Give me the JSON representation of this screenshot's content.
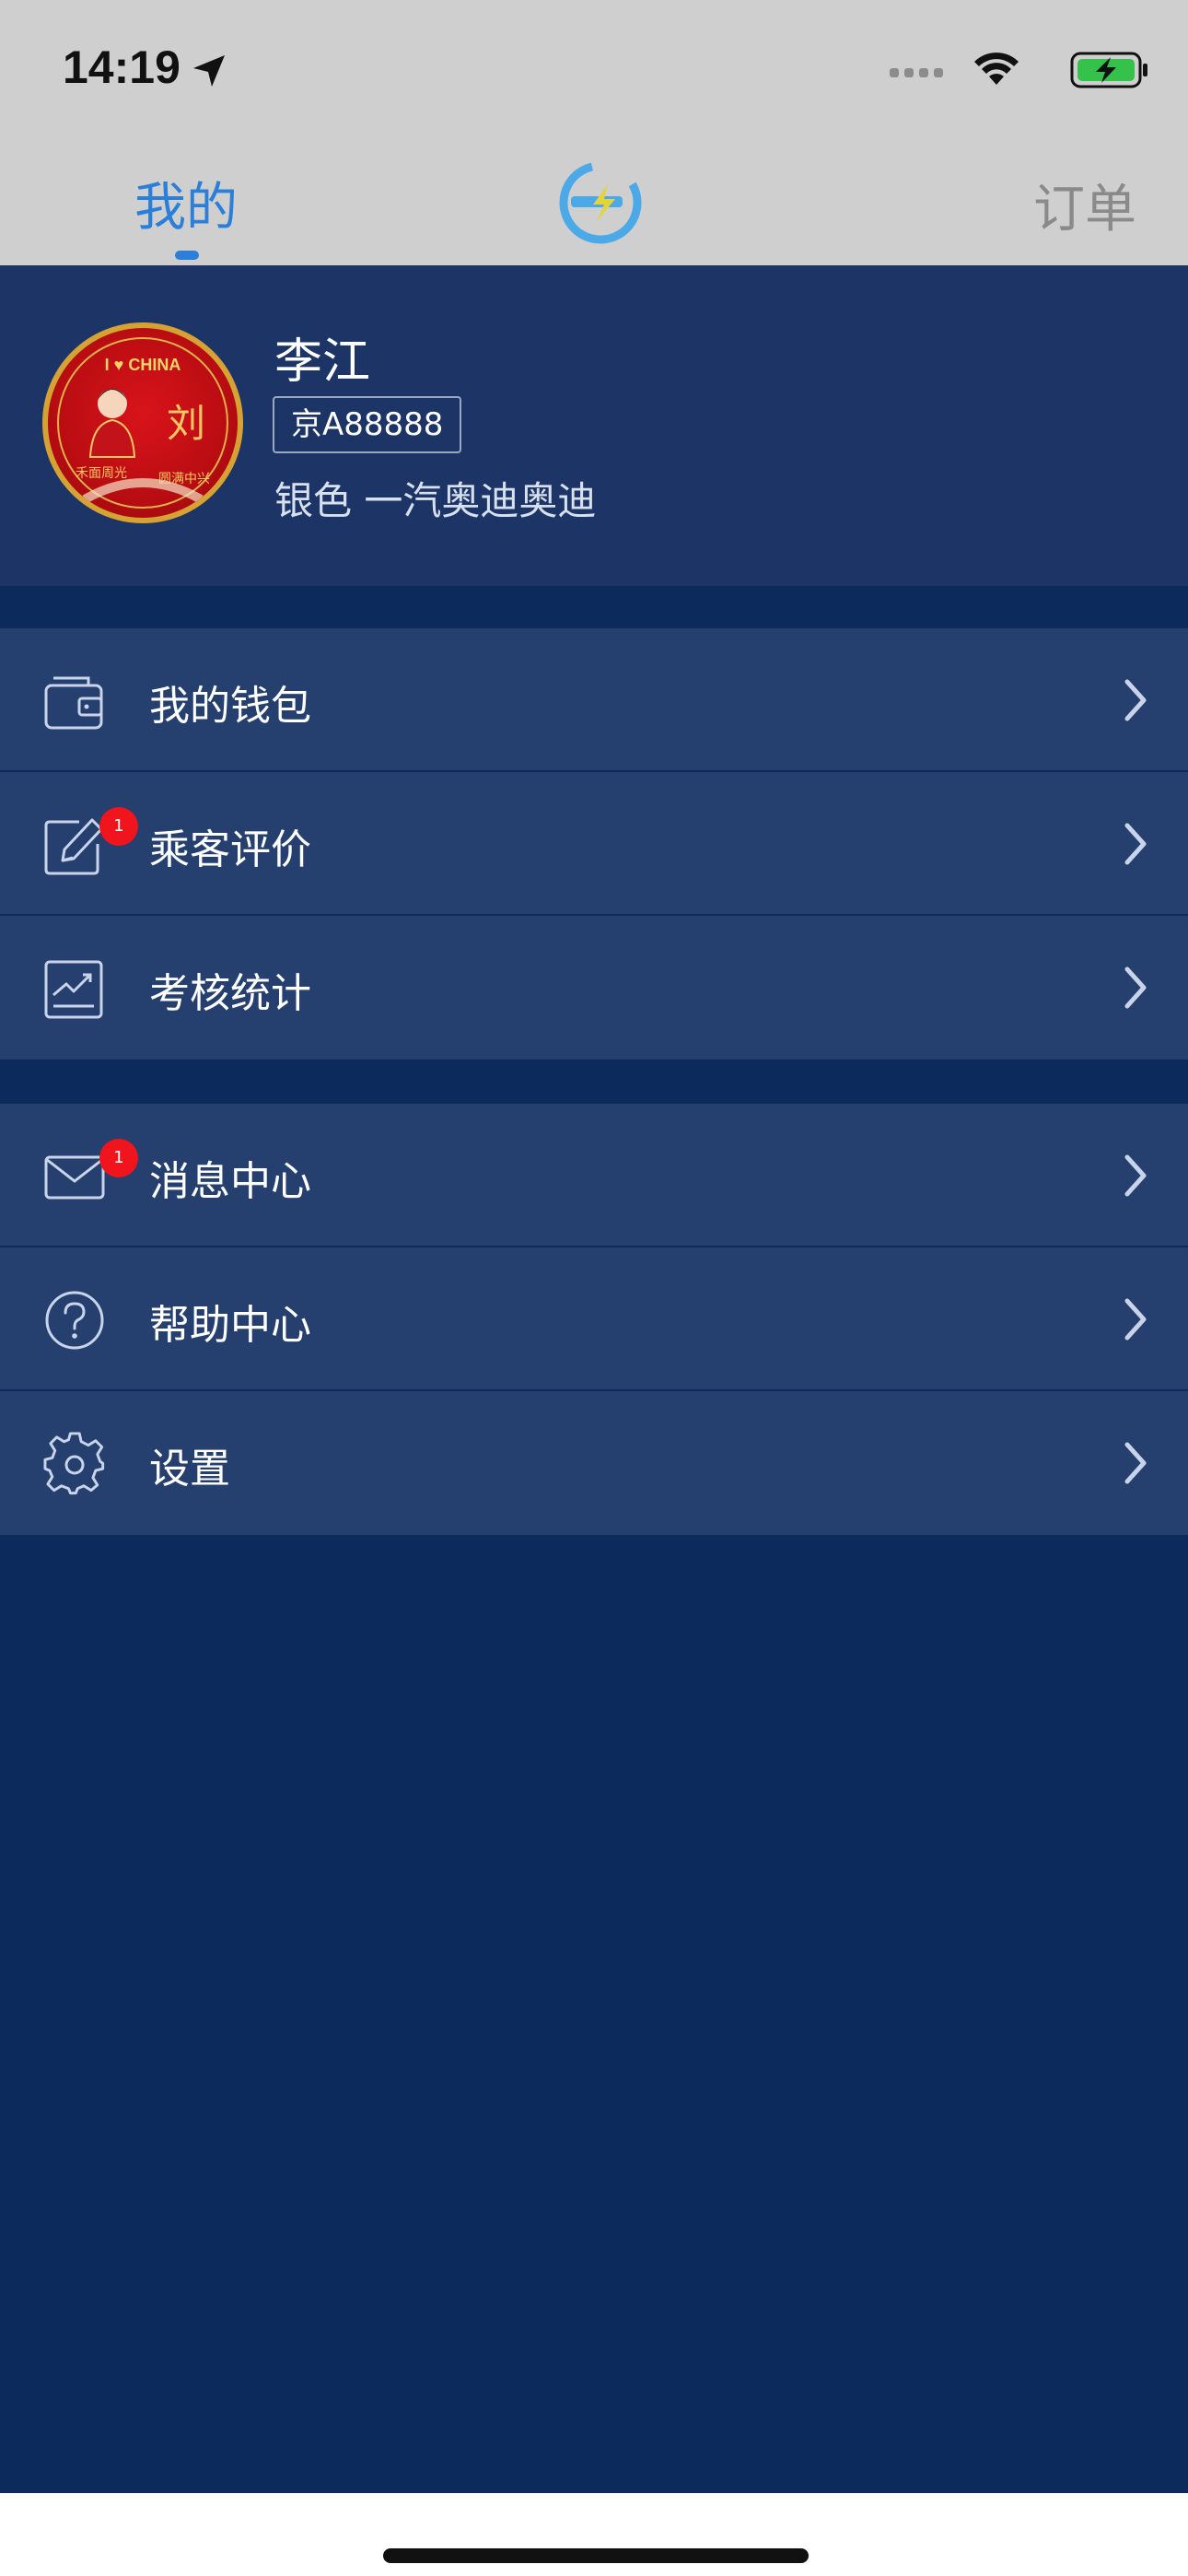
{
  "status_bar": {
    "time": "14:19",
    "icons": [
      "location-arrow-icon",
      "signal-dots-icon",
      "wifi-icon",
      "battery-charging-icon"
    ]
  },
  "nav": {
    "tab_mine": "我的",
    "tab_orders": "订单",
    "logo": "brand-logo",
    "accent_color": "#2b7fd9"
  },
  "profile": {
    "name": "李江",
    "plate": "京A88888",
    "car": "银色 一汽奥迪奥迪",
    "avatar_text": {
      "top": "I ♥ CHINA",
      "char": "刘",
      "left": "禾面周光",
      "right": "圆满中兴"
    }
  },
  "menu": {
    "group1": [
      {
        "label": "我的钱包",
        "icon": "wallet-icon",
        "badge": ""
      },
      {
        "label": "乘客评价",
        "icon": "edit-icon",
        "badge": "1"
      },
      {
        "label": "考核统计",
        "icon": "chart-icon",
        "badge": ""
      }
    ],
    "group2": [
      {
        "label": "消息中心",
        "icon": "mail-icon",
        "badge": "1"
      },
      {
        "label": "帮助中心",
        "icon": "help-icon",
        "badge": ""
      },
      {
        "label": "设置",
        "icon": "gear-icon",
        "badge": ""
      }
    ]
  },
  "colors": {
    "page_bg": "#0c2a5c",
    "row_bg": "#253f6e",
    "badge": "#f0141c"
  }
}
